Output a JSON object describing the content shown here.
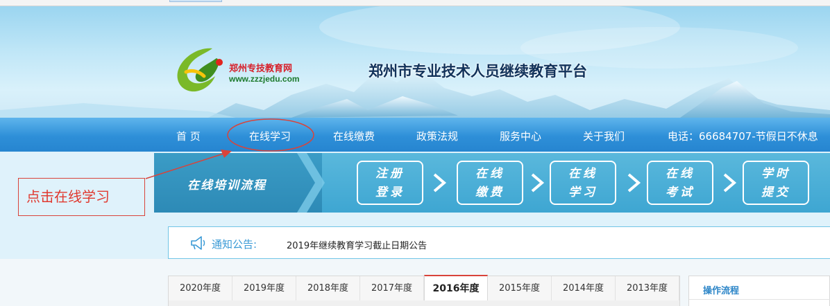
{
  "header": {
    "site_name": "郑州专技教育网",
    "site_url": "www.zzzjedu.com",
    "platform_title": "郑州市专业技术人员继续教育平台"
  },
  "nav": {
    "items": [
      {
        "label": "首 页"
      },
      {
        "label": "在线学习"
      },
      {
        "label": "在线缴费"
      },
      {
        "label": "政策法规"
      },
      {
        "label": "服务中心"
      },
      {
        "label": "关于我们"
      }
    ],
    "phone": "电话：66684707-节假日不休息"
  },
  "annotation": {
    "text": "点击在线学习",
    "color": "#e0392f"
  },
  "process": {
    "label": "在线培训流程",
    "steps": [
      {
        "line1": "注册",
        "line2": "登录"
      },
      {
        "line1": "在线",
        "line2": "缴费"
      },
      {
        "line1": "在线",
        "line2": "学习"
      },
      {
        "line1": "在线",
        "line2": "考试"
      },
      {
        "line1": "学时",
        "line2": "提交"
      }
    ]
  },
  "notice": {
    "label": "通知公告:",
    "text": "2019年继续教育学习截止日期公告"
  },
  "year_tabs": {
    "tabs": [
      "2020年度",
      "2019年度",
      "2018年度",
      "2017年度",
      "2016年度",
      "2015年度",
      "2014年度",
      "2013年度"
    ],
    "active": "2016年度"
  },
  "side_panel": {
    "title": "操作流程"
  },
  "colors": {
    "nav_blue": "#2e8fd8",
    "accent_red": "#d9433a",
    "notice_blue": "#3a9ad6"
  }
}
